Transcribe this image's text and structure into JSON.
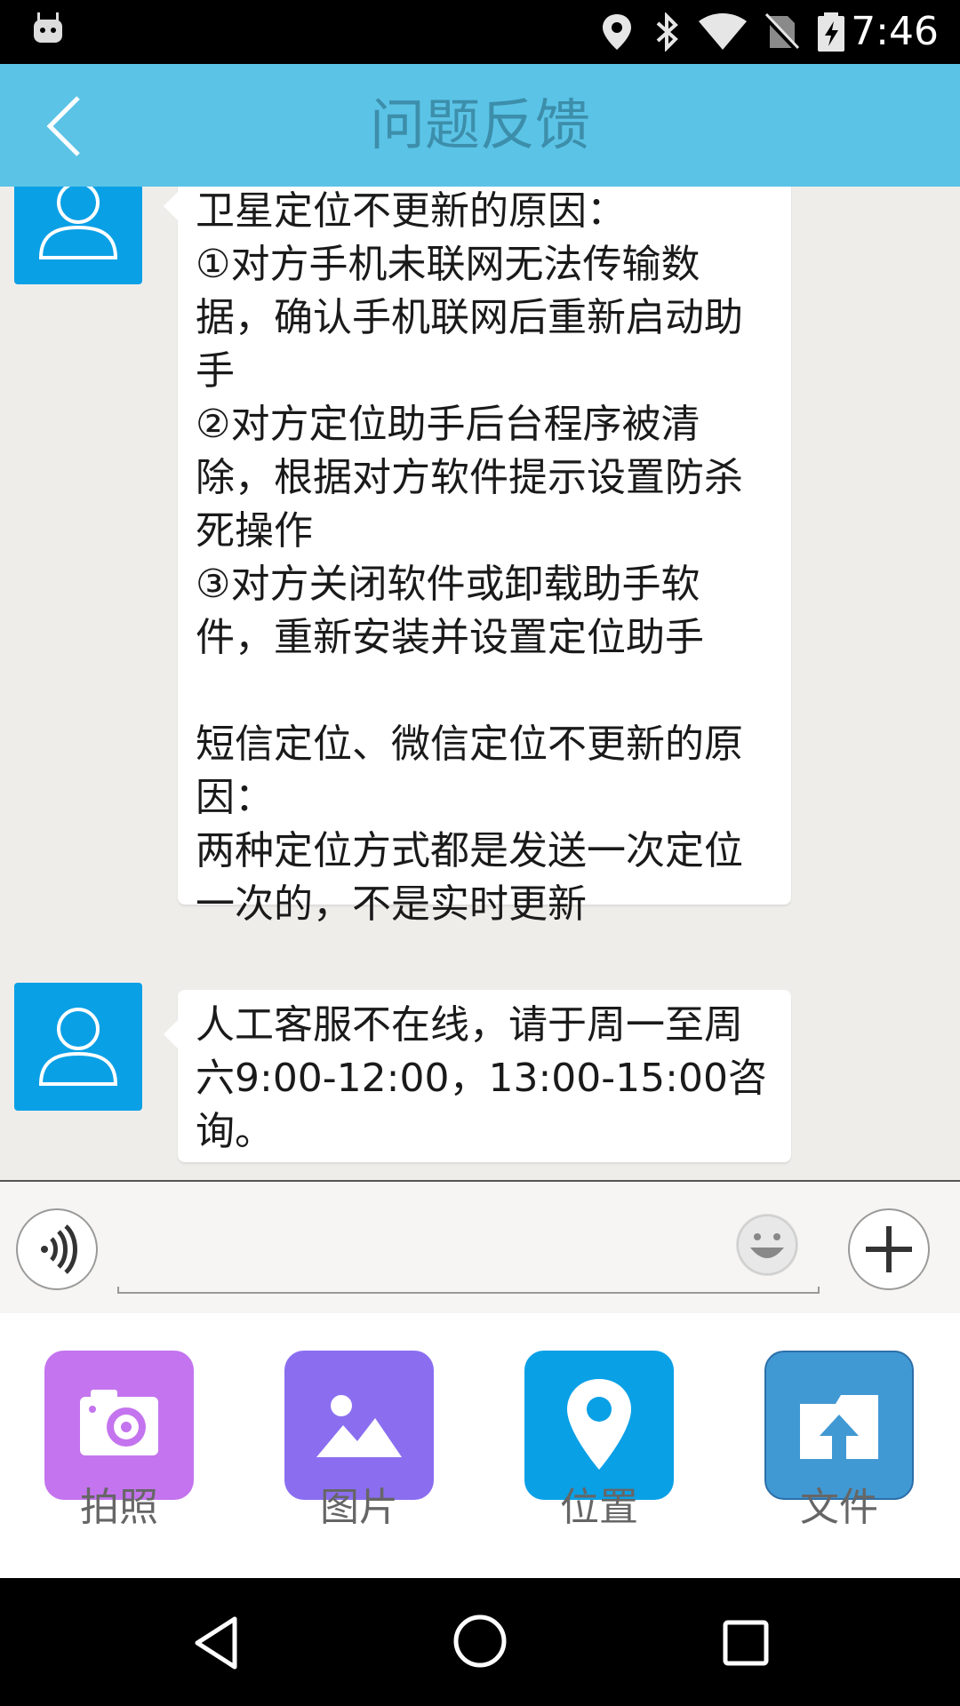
{
  "status_bar": {
    "time": "7:46",
    "icons": [
      "android-icon",
      "location-icon",
      "bluetooth-icon",
      "wifi-icon",
      "no-sim-icon",
      "battery-charging-icon"
    ]
  },
  "header": {
    "title": "问题反馈",
    "back_icon": "chevron-left-icon"
  },
  "chat": {
    "messages": [
      {
        "sender_icon": "user-avatar-icon",
        "text": "卫星定位不更新的原因：\n①对方手机未联网无法传输数据，确认手机联网后重新启动助手\n②对方定位助手后台程序被清除，根据对方软件提示设置防杀死操作\n③对方关闭软件或卸载助手软件，重新安装并设置定位助手\n\n短信定位、微信定位不更新的原因：\n两种定位方式都是发送一次定位一次的，不是实时更新"
      },
      {
        "sender_icon": "user-avatar-icon",
        "text": "人工客服不在线，请于周一至周六9:00-12:00，13:00-15:00咨询。"
      }
    ]
  },
  "input_bar": {
    "voice_icon": "voice-icon",
    "emoji_icon": "emoji-icon",
    "plus_icon": "plus-icon",
    "input_value": ""
  },
  "attach_panel": {
    "items": [
      {
        "label": "拍照",
        "icon": "camera-icon",
        "color": "#c474ee"
      },
      {
        "label": "图片",
        "icon": "image-icon",
        "color": "#8b6ef0"
      },
      {
        "label": "位置",
        "icon": "location-pin-icon",
        "color": "#0aa0e6"
      },
      {
        "label": "文件",
        "icon": "file-upload-icon",
        "color": "#4199d4"
      }
    ]
  },
  "nav_bar": {
    "icons": [
      "back-triangle-icon",
      "home-circle-icon",
      "recents-square-icon"
    ]
  }
}
